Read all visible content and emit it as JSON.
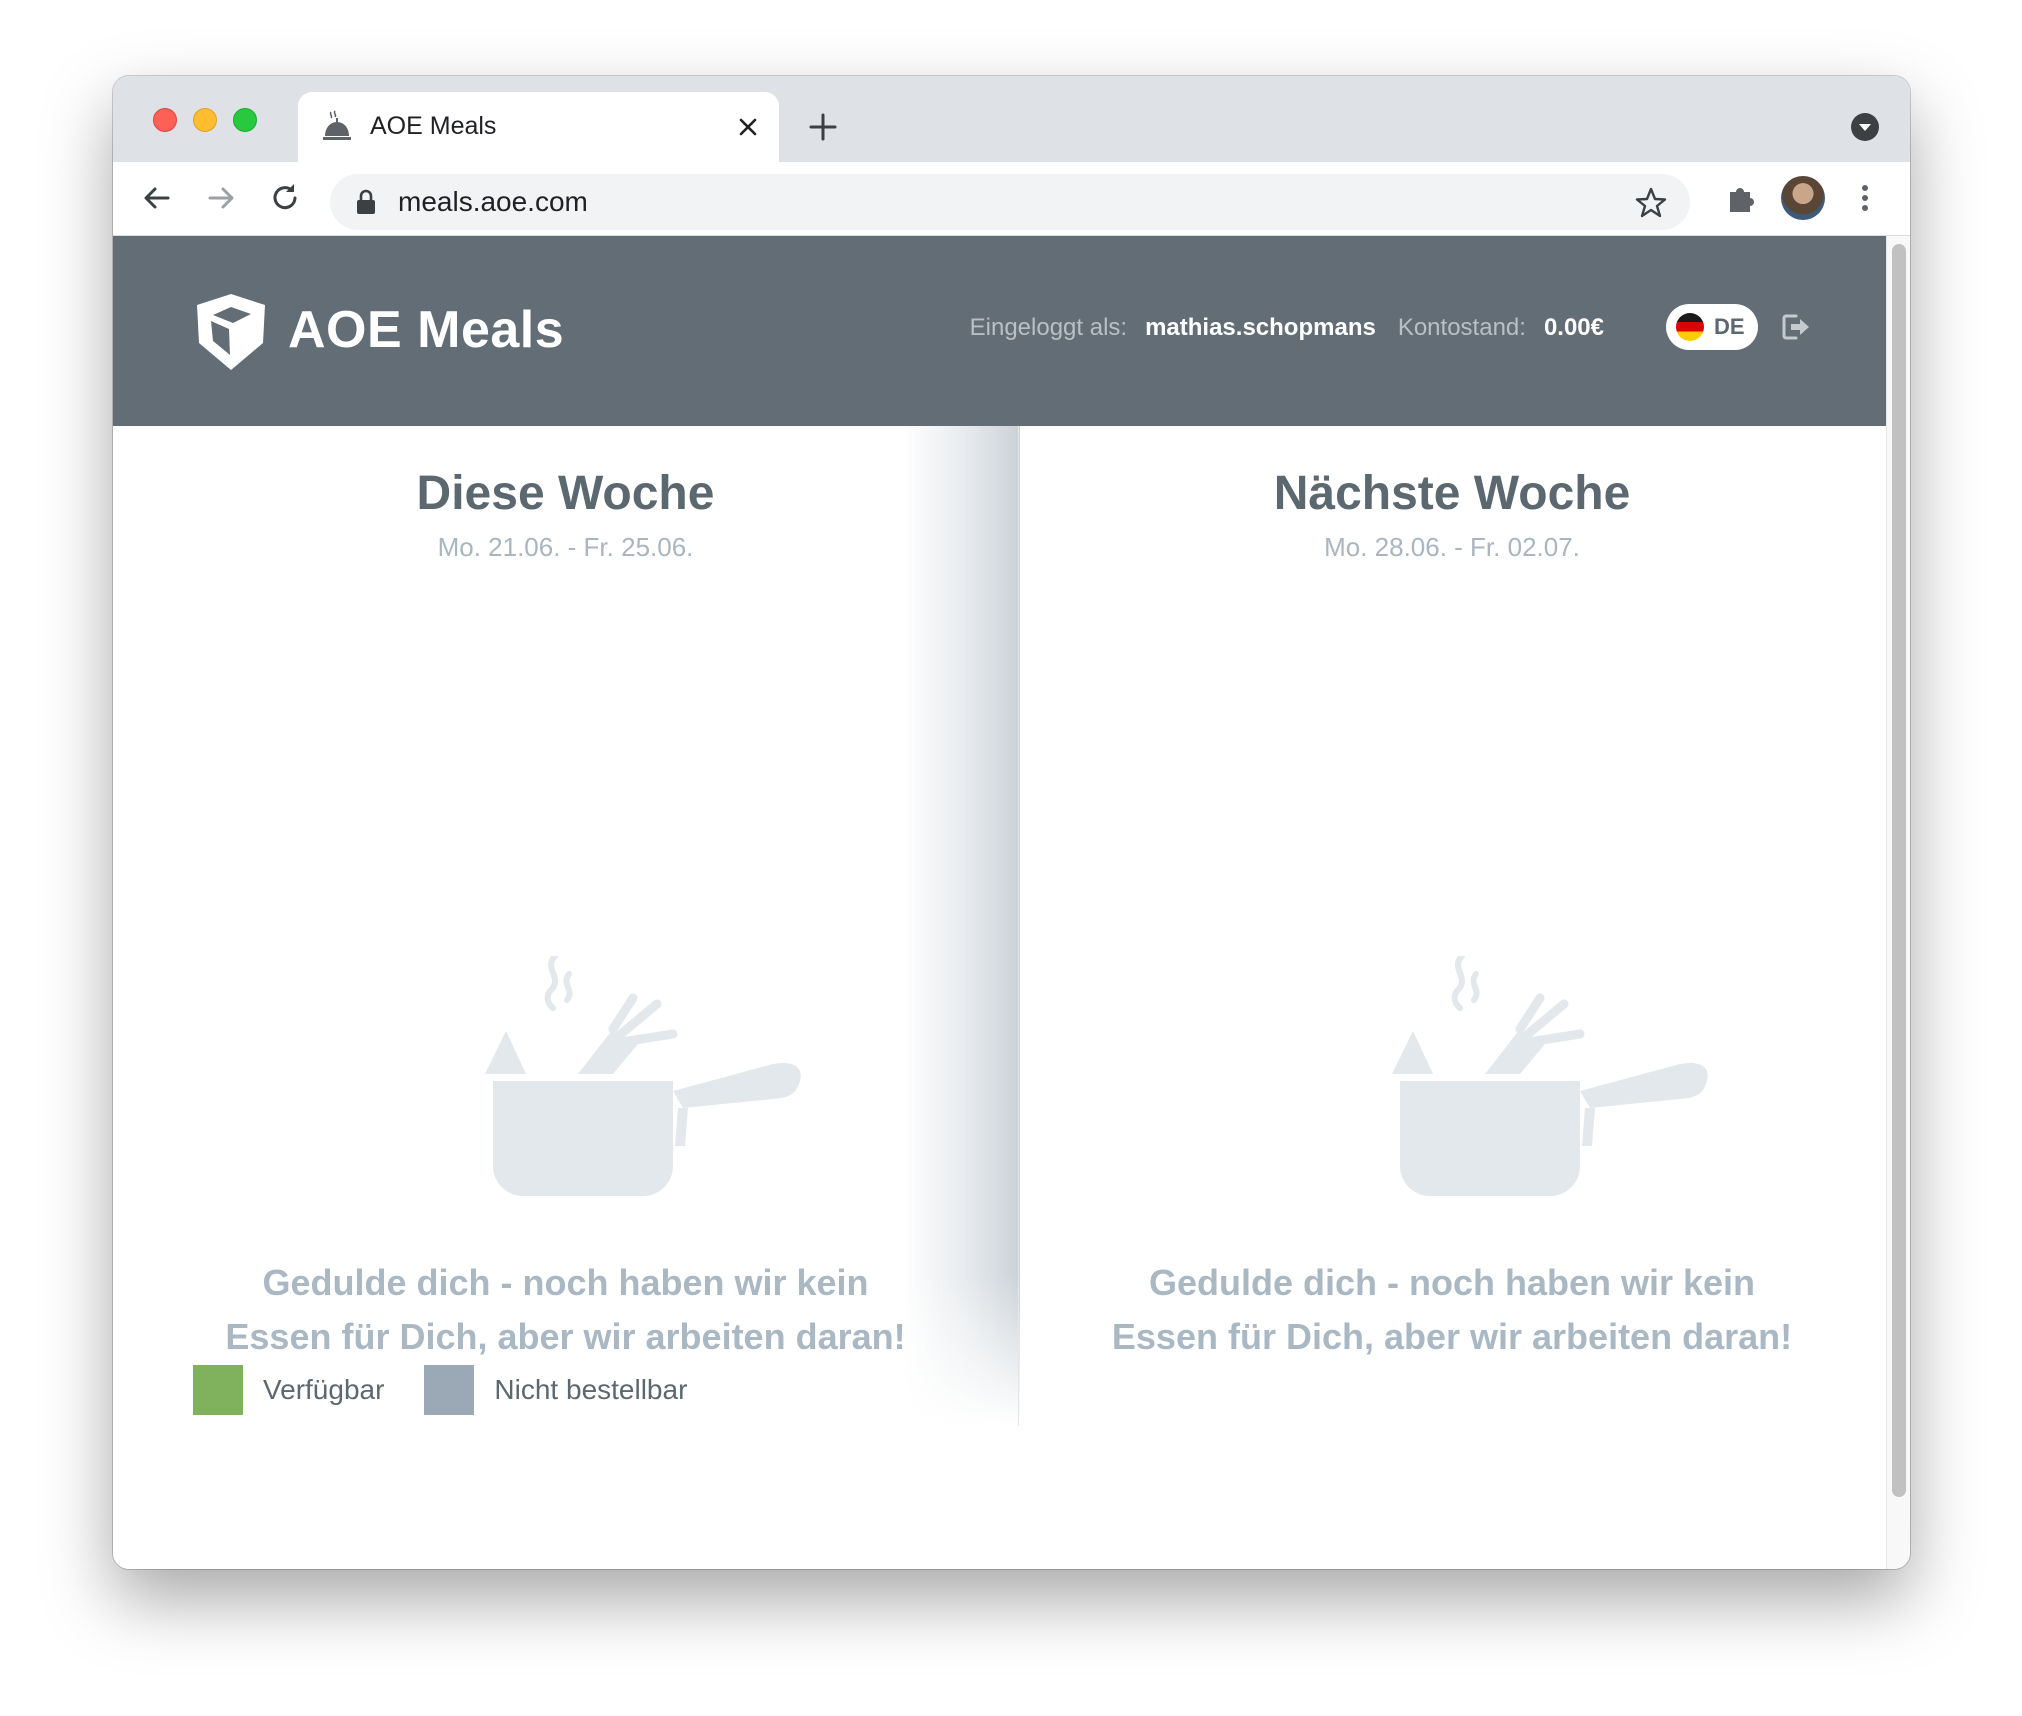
{
  "browser": {
    "tab_title": "AOE Meals",
    "url": "meals.aoe.com"
  },
  "header": {
    "brand": "AOE Meals",
    "logged_in_label": "Eingeloggt als:",
    "username": "mathias.schopmans",
    "balance_label": "Kontostand:",
    "balance": "0.00€",
    "language": "DE"
  },
  "weeks": [
    {
      "title": "Diese Woche",
      "range": "Mo. 21.06. - Fr. 25.06.",
      "empty_line1": "Gedulde dich - noch haben wir kein",
      "empty_line2": "Essen für Dich, aber wir arbeiten daran!"
    },
    {
      "title": "Nächste Woche",
      "range": "Mo. 28.06. - Fr. 02.07.",
      "empty_line1": "Gedulde dich - noch haben wir kein",
      "empty_line2": "Essen für Dich, aber wir arbeiten daran!"
    }
  ],
  "legend": {
    "available": "Verfügbar",
    "unavailable": "Nicht bestellbar"
  },
  "colors": {
    "header_bg": "#626d75",
    "available": "#80b15c",
    "unavailable": "#9aa9b5",
    "placeholder": "#a9b8c3"
  }
}
